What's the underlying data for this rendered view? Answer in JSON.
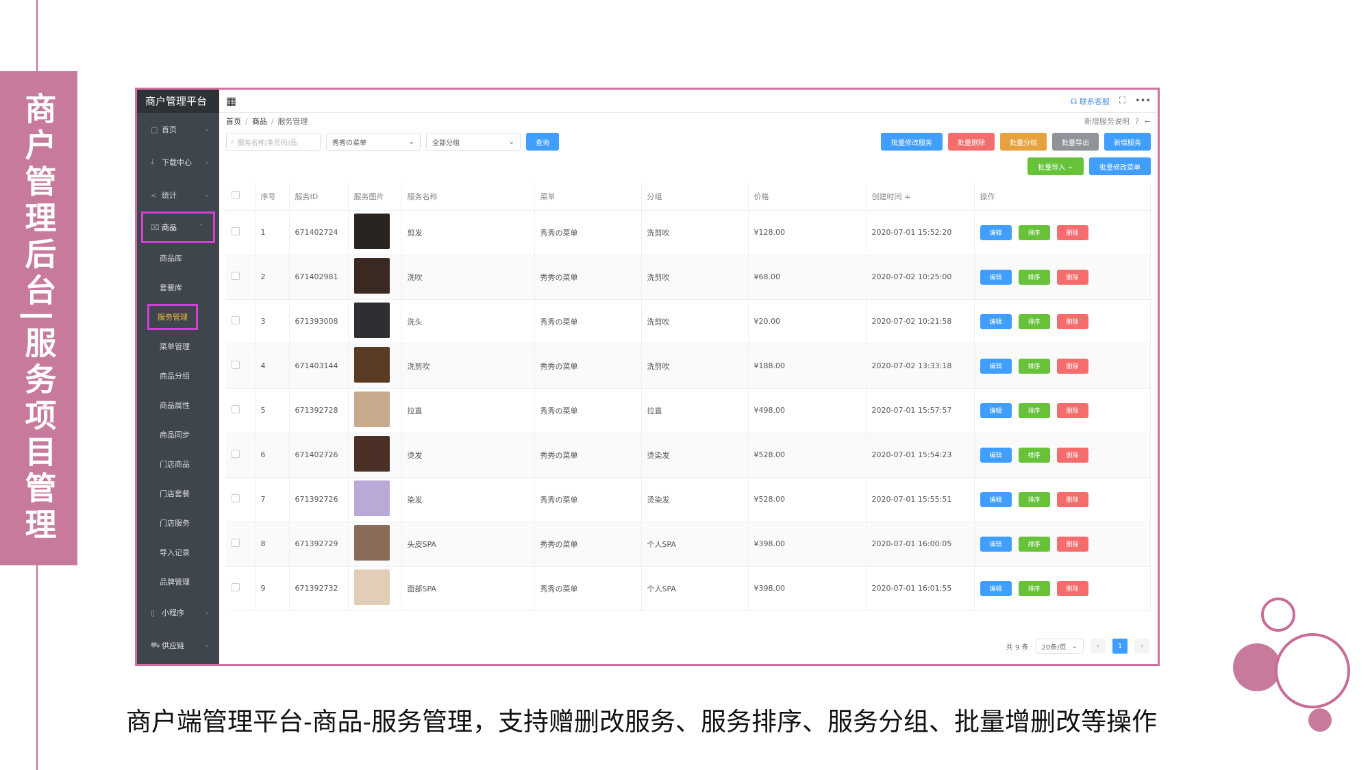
{
  "banner_text": "商户管理后台|服务项目管理",
  "caption": "商户端管理平台-商品-服务管理，支持赠删改服务、服务排序、服务分组、批量增删改等操作",
  "app": {
    "brand": "商户管理平台",
    "contact": "联系客服",
    "nav": {
      "home": "首页",
      "download": "下载中心",
      "stats": "统计",
      "goods": "商品",
      "sub": [
        "商品库",
        "套餐库",
        "服务管理",
        "菜单管理",
        "商品分组",
        "商品属性",
        "商品同步",
        "门店商品",
        "门店套餐",
        "门店服务",
        "导入记录",
        "品牌管理"
      ],
      "mini": "小程序",
      "supply": "供应链"
    },
    "breadcrumb": {
      "home": "首页",
      "goods": "商品",
      "current": "服务管理"
    },
    "help": "新增服务说明",
    "filter": {
      "search_placeholder": "服务名称/条形码/品",
      "menu_value": "秀秀の菜单",
      "group_value": "全部分组",
      "query": "查询"
    },
    "actions": {
      "batch_edit_service": "批量修改服务",
      "batch_delete": "批量删除",
      "batch_group": "批量分组",
      "batch_export": "批量导出",
      "add_service": "新增服务",
      "batch_import": "批量导入",
      "batch_edit_menu": "批量修改菜单"
    },
    "table": {
      "headers": [
        "序号",
        "服务ID",
        "服务图片",
        "服务名称",
        "菜单",
        "分组",
        "价格",
        "创建时间 ≑",
        "操作"
      ],
      "op_labels": {
        "edit": "编辑",
        "sort": "排序",
        "delete": "删除"
      },
      "rows": [
        {
          "no": "1",
          "id": "671402724",
          "name": "剪发",
          "menu": "秀秀の菜单",
          "group": "洗剪吹",
          "price": "¥128.00",
          "time": "2020-07-01 15:52:20",
          "thumb": "#2a2420"
        },
        {
          "no": "2",
          "id": "671402981",
          "name": "洗吹",
          "menu": "秀秀の菜单",
          "group": "洗剪吹",
          "price": "¥68.00",
          "time": "2020-07-02 10:25:00",
          "thumb": "#3b2a22"
        },
        {
          "no": "3",
          "id": "671393008",
          "name": "洗头",
          "menu": "秀秀の菜单",
          "group": "洗剪吹",
          "price": "¥20.00",
          "time": "2020-07-02 10:21:58",
          "thumb": "#2f2f33"
        },
        {
          "no": "4",
          "id": "671403144",
          "name": "洗剪吹",
          "menu": "秀秀の菜单",
          "group": "洗剪吹",
          "price": "¥188.00",
          "time": "2020-07-02 13:33:18",
          "thumb": "#5a3b24"
        },
        {
          "no": "5",
          "id": "671392728",
          "name": "拉直",
          "menu": "秀秀の菜单",
          "group": "拉直",
          "price": "¥498.00",
          "time": "2020-07-01 15:57:57",
          "thumb": "#c9a98c"
        },
        {
          "no": "6",
          "id": "671402726",
          "name": "烫发",
          "menu": "秀秀の菜单",
          "group": "烫染发",
          "price": "¥528.00",
          "time": "2020-07-01 15:54:23",
          "thumb": "#4a3026"
        },
        {
          "no": "7",
          "id": "671392726",
          "name": "染发",
          "menu": "秀秀の菜单",
          "group": "烫染发",
          "price": "¥528.00",
          "time": "2020-07-01 15:55:51",
          "thumb": "#b8a9d6"
        },
        {
          "no": "8",
          "id": "671392729",
          "name": "头皮SPA",
          "menu": "秀秀の菜单",
          "group": "个人SPA",
          "price": "¥398.00",
          "time": "2020-07-01 16:00:05",
          "thumb": "#8a6a58"
        },
        {
          "no": "9",
          "id": "671392732",
          "name": "面部SPA",
          "menu": "秀秀の菜单",
          "group": "个人SPA",
          "price": "¥398.00",
          "time": "2020-07-01 16:01:55",
          "thumb": "#e2cdb8"
        }
      ]
    },
    "pager": {
      "total": "共 9 条",
      "size": "20条/页",
      "page": "1"
    }
  },
  "colors": {
    "accent_pink": "#c87a9c",
    "highlight_magenta": "#d43fd6",
    "primary_blue": "#409eff"
  }
}
